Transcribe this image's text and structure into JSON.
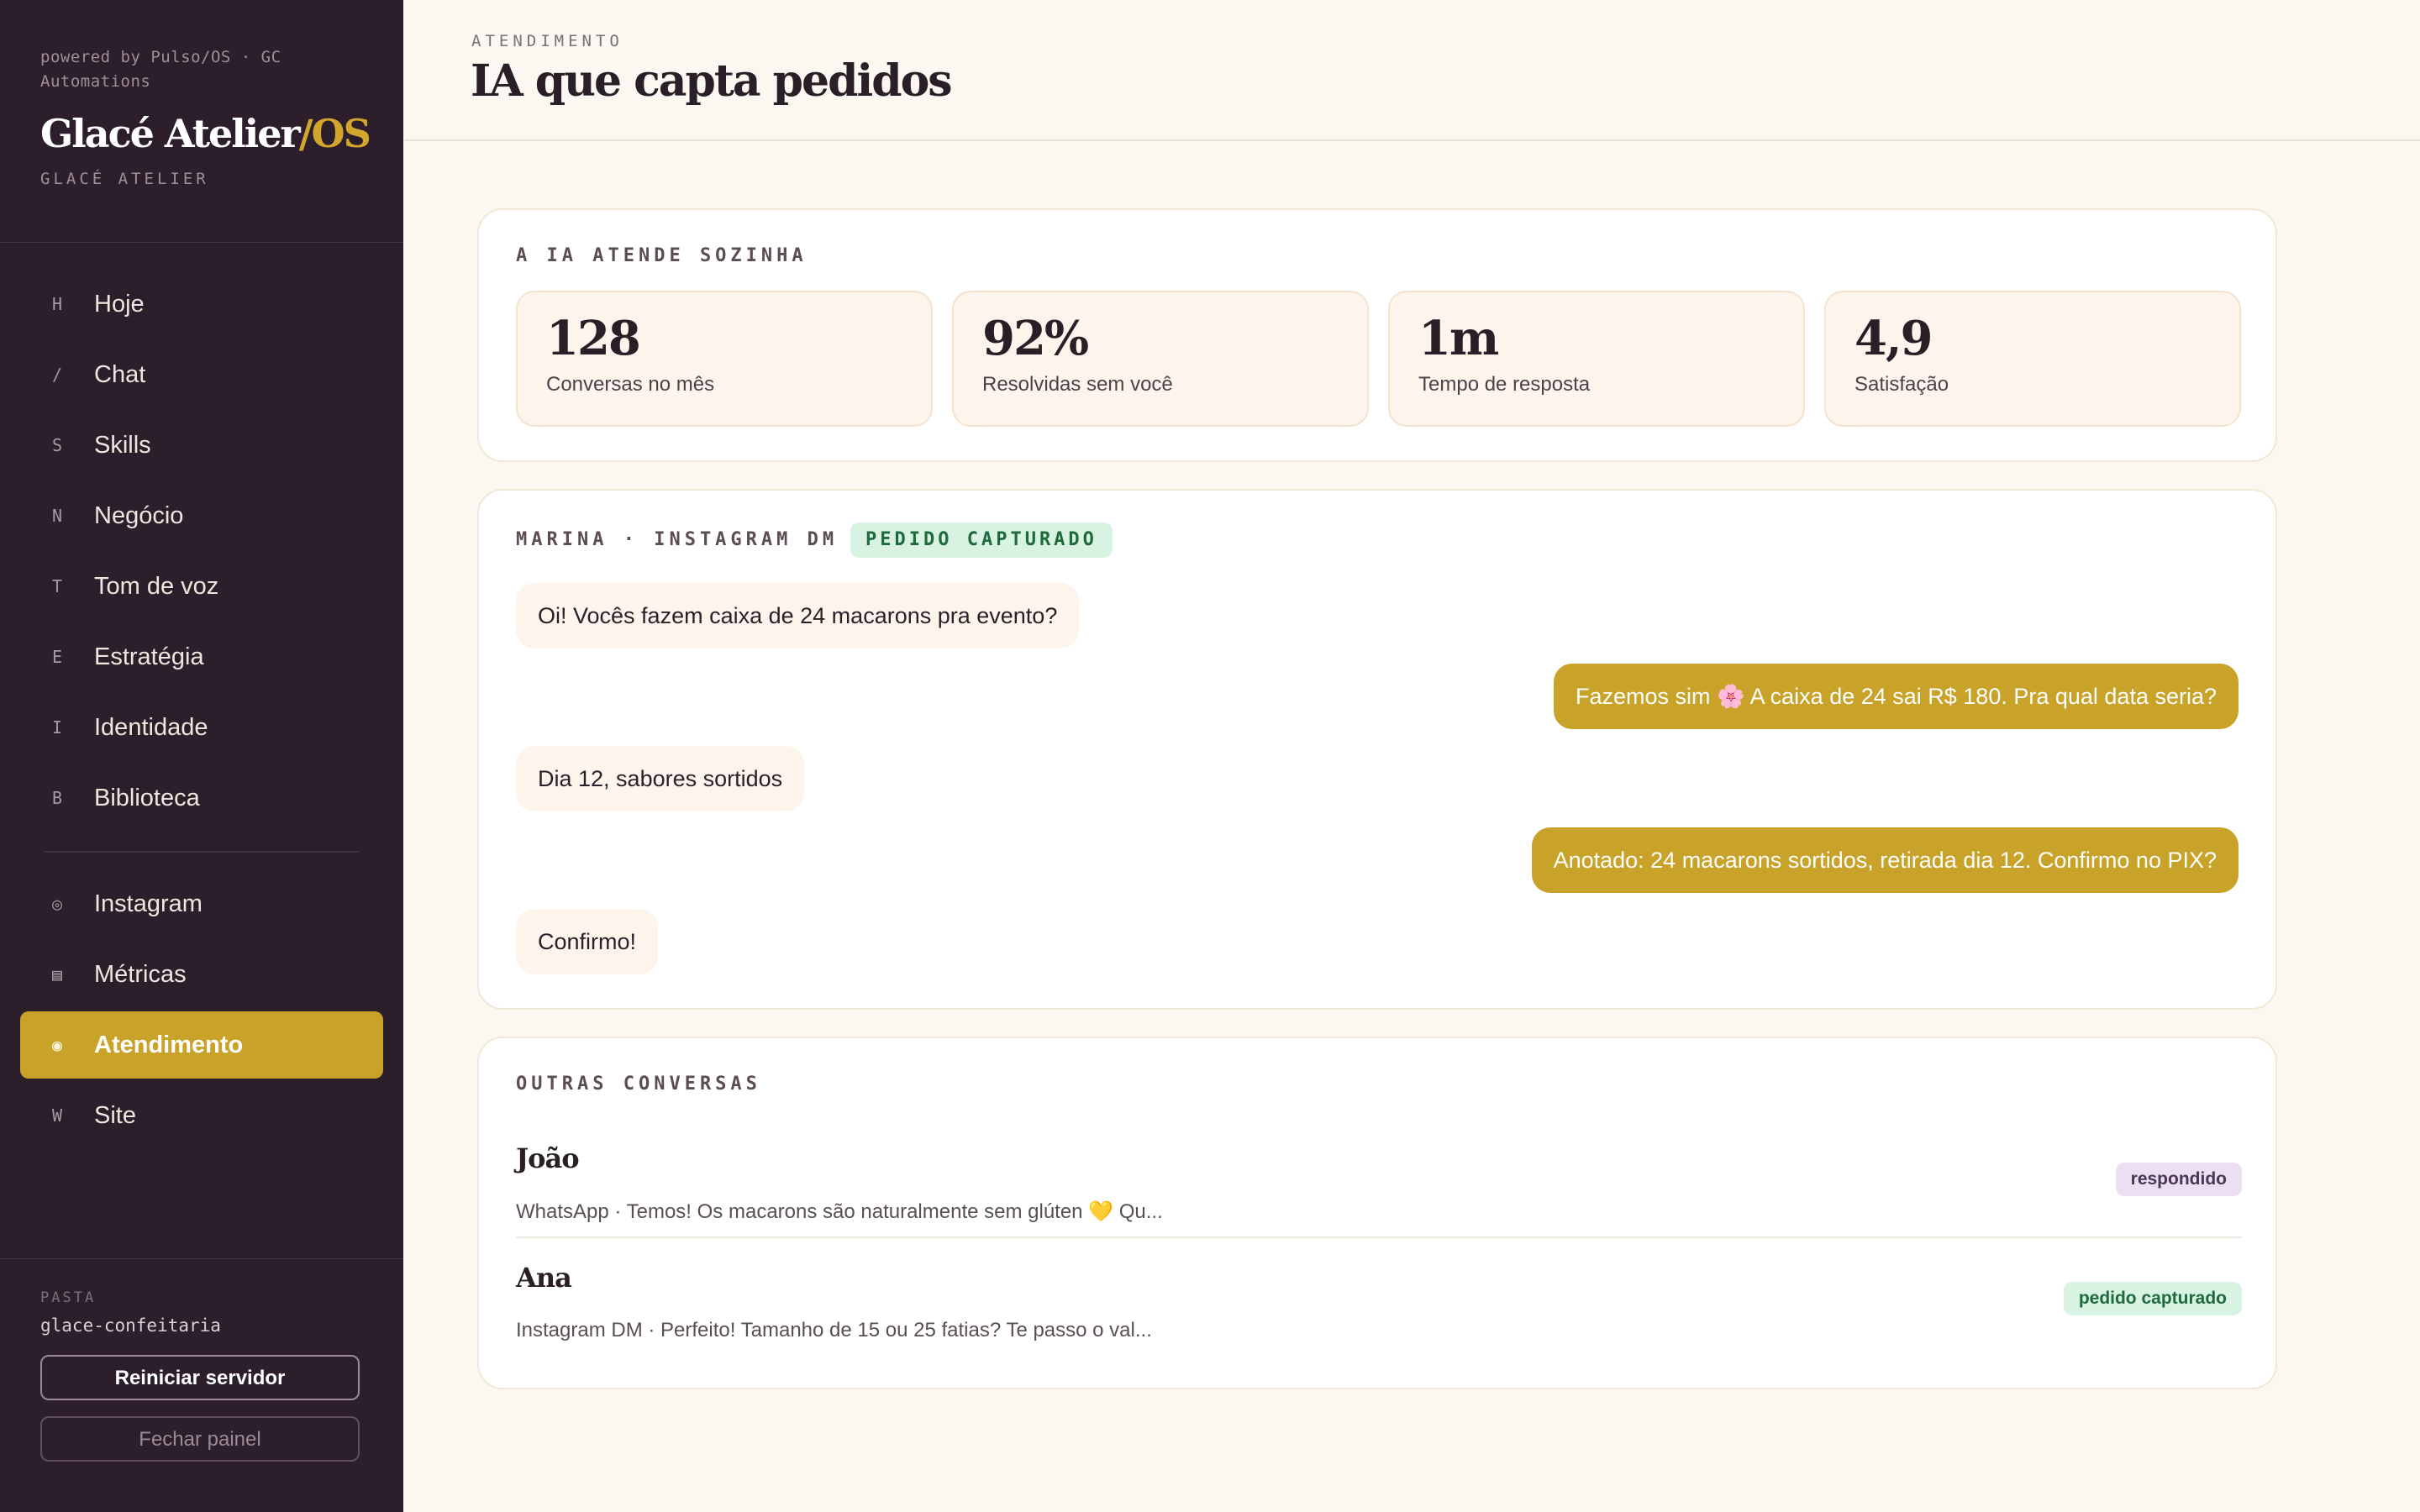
{
  "sidebar": {
    "powered_by": "powered by Pulso/OS · GC Automations",
    "brand_name": "Glacé Atelier",
    "brand_suffix": "/OS",
    "brand_sub": "GLACÉ ATELIER",
    "nav": [
      {
        "key": "H",
        "label": "Hoje"
      },
      {
        "key": "/",
        "label": "Chat"
      },
      {
        "key": "S",
        "label": "Skills"
      },
      {
        "key": "N",
        "label": "Negócio"
      },
      {
        "key": "T",
        "label": "Tom de voz"
      },
      {
        "key": "E",
        "label": "Estratégia"
      },
      {
        "key": "I",
        "label": "Identidade"
      },
      {
        "key": "B",
        "label": "Biblioteca"
      }
    ],
    "nav2": [
      {
        "key": "◎",
        "label": "Instagram"
      },
      {
        "key": "▤",
        "label": "Métricas"
      },
      {
        "key": "◉",
        "label": "Atendimento",
        "active": true
      },
      {
        "key": "W",
        "label": "Site"
      }
    ],
    "pasta_label": "PASTA",
    "pasta_value": "glace-confeitaria",
    "restart_label": "Reiniciar servidor",
    "close_label": "Fechar painel"
  },
  "header": {
    "eyebrow": "ATENDIMENTO",
    "title": "IA que capta pedidos"
  },
  "stats_card": {
    "eyebrow": "A IA ATENDE SOZINHA",
    "stats": [
      {
        "value": "128",
        "caption": "Conversas no mês"
      },
      {
        "value": "92%",
        "caption": "Resolvidas sem você"
      },
      {
        "value": "1m",
        "caption": "Tempo de resposta"
      },
      {
        "value": "4,9",
        "caption": "Satisfação"
      }
    ]
  },
  "chat_card": {
    "eyebrow": "MARINA · INSTAGRAM DM",
    "badge": "PEDIDO CAPTURADO",
    "messages": [
      {
        "from": "client",
        "text": "Oi! Vocês fazem caixa de 24 macarons pra evento?"
      },
      {
        "from": "ai",
        "text": "Fazemos sim 🌸 A caixa de 24 sai R$ 180. Pra qual data seria?"
      },
      {
        "from": "client",
        "text": "Dia 12, sabores sortidos"
      },
      {
        "from": "ai",
        "text": "Anotado: 24 macarons sortidos, retirada dia 12. Confirmo no PIX?"
      },
      {
        "from": "client",
        "text": "Confirmo!"
      }
    ]
  },
  "others_card": {
    "eyebrow": "OUTRAS CONVERSAS",
    "conversations": [
      {
        "name": "João",
        "preview": "WhatsApp · Temos! Os macarons são naturalmente sem glúten 💛 Qu...",
        "tag": "respondido"
      },
      {
        "name": "Ana",
        "preview": "Instagram DM · Perfeito! Tamanho de 15 ou 25 fatias? Te passo o val...",
        "tag": "pedido capturado"
      }
    ]
  },
  "colors": {
    "sidebar_bg": "#2c1f2b",
    "accent": "#c9a22a",
    "page_bg": "#fbf8f2",
    "success_bg": "#d9f3e2",
    "success_fg": "#1f6a3c"
  }
}
